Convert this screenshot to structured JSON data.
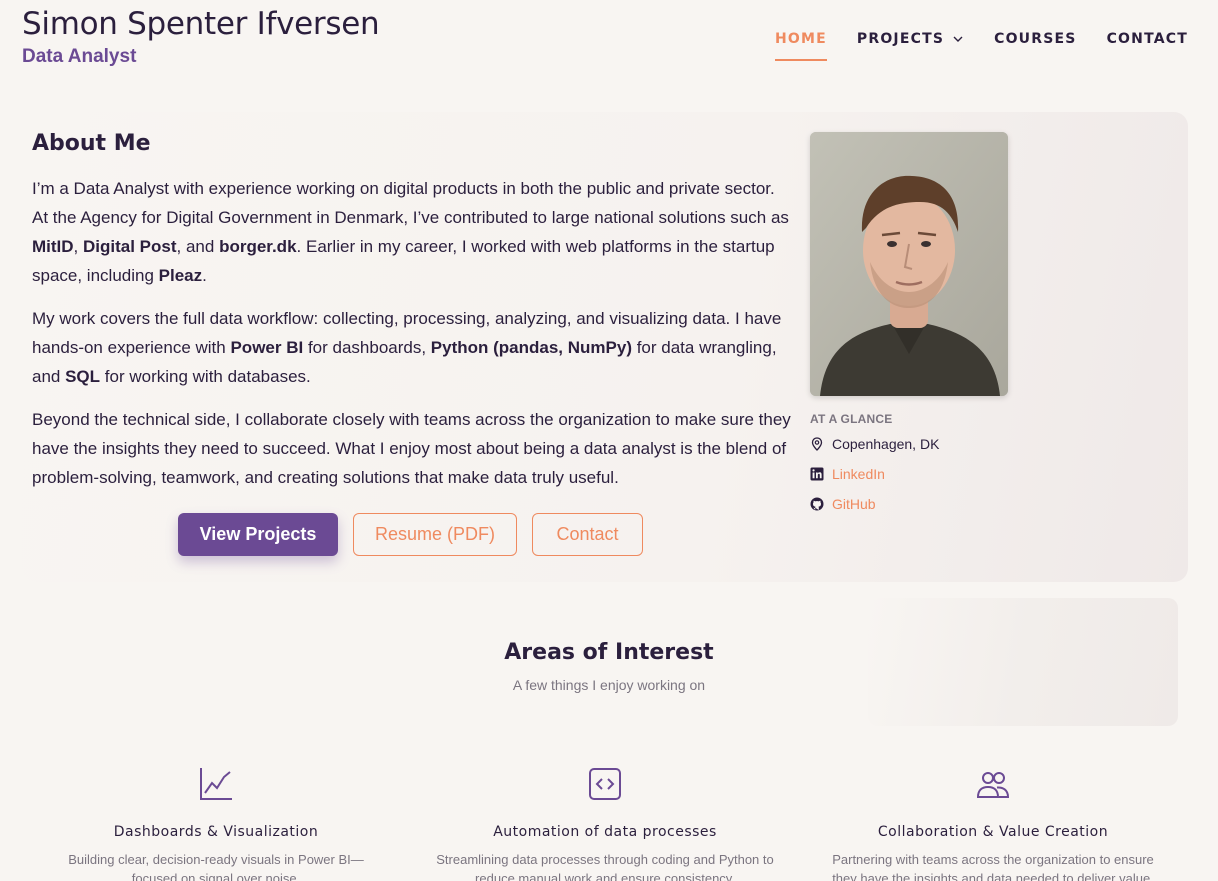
{
  "header": {
    "title": "Simon Spenter Ifversen",
    "subtitle": "Data Analyst",
    "nav": [
      {
        "label": "HOME"
      },
      {
        "label": "PROJECTS"
      },
      {
        "label": "COURSES"
      },
      {
        "label": "CONTACT"
      }
    ]
  },
  "about": {
    "title": "About Me",
    "p1": {
      "a": "I’m a Data Analyst with experience working on digital products in both the public and private sector. At the Agency for Digital Government in Denmark, I’ve contributed to large national solutions such as ",
      "b1": "MitID",
      "c": ", ",
      "b2": "Digital Post",
      "d": ", and ",
      "b3": "borger.dk",
      "e": ". Earlier in my career, I worked with web platforms in the startup space, including ",
      "b4": "Pleaz",
      "f": "."
    },
    "p2": {
      "a": "My work covers the full data workflow: collecting, processing, analyzing, and visualizing data. I have hands-on experience with ",
      "b1": "Power BI",
      "c": " for dashboards, ",
      "b2": "Python (pandas, NumPy)",
      "d": " for data wrangling, and ",
      "b3": "SQL",
      "e": " for working with databases."
    },
    "p3": "Beyond the technical side, I collaborate closely with teams across the organization to make sure they have the insights they need to succeed. What I enjoy most about being a data analyst is the blend of problem-solving, teamwork, and creating solutions that make data truly useful.",
    "buttons": {
      "projects": "View Projects",
      "resume": "Resume (PDF)",
      "contact": "Contact"
    }
  },
  "glance": {
    "label": "AT A GLANCE",
    "location": "Copenhagen, DK",
    "linkedin": "LinkedIn",
    "github": "GitHub"
  },
  "areas": {
    "title": "Areas of Interest",
    "subtitle": "A few things I enjoy working on",
    "items": [
      {
        "title": "Dashboards & Visualization",
        "desc": "Building clear, decision-ready visuals in Power BI—focused on signal over noise."
      },
      {
        "title": "Automation of data processes",
        "desc": "Streamlining data processes through coding and Python to reduce manual work and ensure consistency."
      },
      {
        "title": "Collaboration & Value Creation",
        "desc": "Partnering with teams across the organization to ensure they have the insights and data needed to deliver value."
      }
    ]
  },
  "colors": {
    "accent": "#ef8a5f",
    "brand": "#6b4a94",
    "text": "#2b1f3d",
    "background": "#f8f5f2"
  }
}
